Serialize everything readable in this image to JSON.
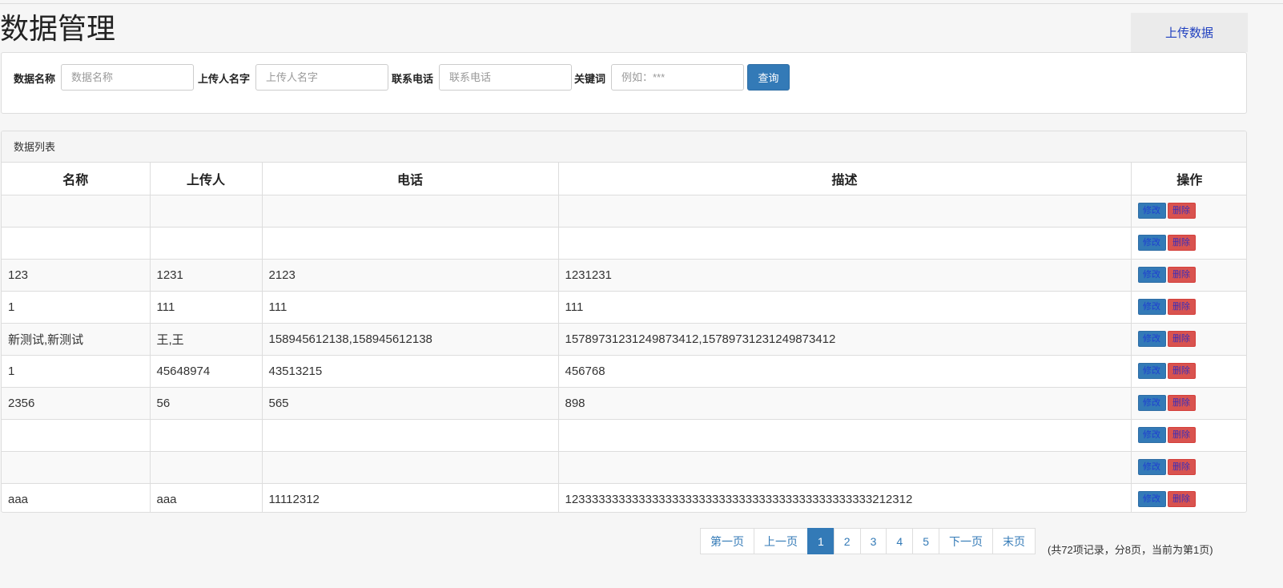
{
  "header": {
    "title": "数据管理",
    "upload_label": "上传数据"
  },
  "search": {
    "name_label": "数据名称",
    "name_placeholder": "数据名称",
    "uploader_label": "上传人名字",
    "uploader_placeholder": "上传人名字",
    "phone_label": "联系电话",
    "phone_placeholder": "联系电话",
    "keyword_label": "关键词",
    "keyword_placeholder": "例如：***",
    "query_label": "查询"
  },
  "list": {
    "heading": "数据列表",
    "columns": [
      "名称",
      "上传人",
      "电话",
      "描述",
      "操作"
    ],
    "edit_label": "修改",
    "delete_label": "删除",
    "rows": [
      {
        "name": "",
        "uploader": "",
        "phone": "",
        "desc": ""
      },
      {
        "name": "",
        "uploader": "",
        "phone": "",
        "desc": ""
      },
      {
        "name": "123",
        "uploader": "1231",
        "phone": "2123",
        "desc": "1231231"
      },
      {
        "name": "1",
        "uploader": "111",
        "phone": "111",
        "desc": "111"
      },
      {
        "name": "新测试,新测试",
        "uploader": "王,王",
        "phone": "158945612138,158945612138",
        "desc": "15789731231249873412,15789731231249873412"
      },
      {
        "name": "1",
        "uploader": "45648974",
        "phone": "43513215",
        "desc": "456768"
      },
      {
        "name": "2356",
        "uploader": "56",
        "phone": "565",
        "desc": "898"
      },
      {
        "name": "",
        "uploader": "",
        "phone": "",
        "desc": ""
      },
      {
        "name": "",
        "uploader": "",
        "phone": "",
        "desc": ""
      },
      {
        "name": "aaa",
        "uploader": "aaa",
        "phone": "11112312",
        "desc": "1233333333333333333333333333333333333333333333212312"
      }
    ]
  },
  "pagination": {
    "first": "第一页",
    "prev": "上一页",
    "pages": [
      "1",
      "2",
      "3",
      "4",
      "5"
    ],
    "current": "1",
    "next": "下一页",
    "last": "末页",
    "info": "(共72项记录，分8页，当前为第1页)"
  }
}
